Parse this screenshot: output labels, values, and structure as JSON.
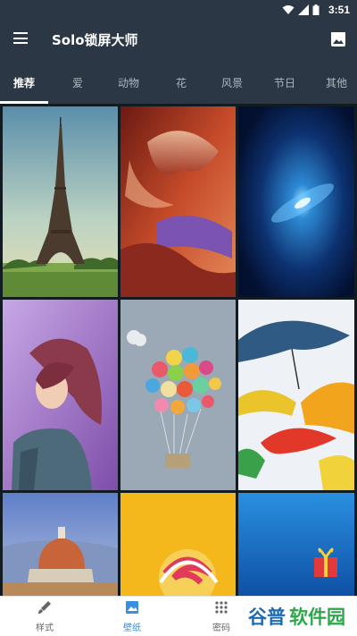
{
  "status": {
    "time": "3:51"
  },
  "app": {
    "title": "Solo锁屏大师"
  },
  "tabs": [
    {
      "label": "推荐",
      "active": true
    },
    {
      "label": "爱"
    },
    {
      "label": "动物"
    },
    {
      "label": "花"
    },
    {
      "label": "风景"
    },
    {
      "label": "节日"
    },
    {
      "label": "其他"
    }
  ],
  "wallpapers": [
    {
      "subject": "eiffel-tower"
    },
    {
      "subject": "red-canyon"
    },
    {
      "subject": "blue-galaxy"
    },
    {
      "subject": "girl-portrait"
    },
    {
      "subject": "button-balloon"
    },
    {
      "subject": "umbrellas"
    },
    {
      "subject": "florence-dome"
    },
    {
      "subject": "lollipop"
    },
    {
      "subject": "blue-gift"
    }
  ],
  "bottom_nav": [
    {
      "label": "样式",
      "icon": "brush-icon"
    },
    {
      "label": "壁纸",
      "icon": "image-icon",
      "active": true
    },
    {
      "label": "密码",
      "icon": "grid-lock-icon"
    }
  ],
  "watermark": {
    "text": "谷普软件园"
  }
}
